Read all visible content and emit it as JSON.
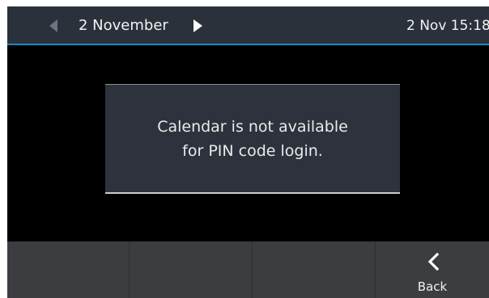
{
  "header": {
    "date_title": "2 November",
    "clock": "2 Nov 15:18",
    "prev_icon": "chevron-left-icon",
    "next_icon": "chevron-right-icon",
    "accent_color": "#1a88c9"
  },
  "dialog": {
    "message": "Calendar is not available\nfor PIN code login."
  },
  "softkeys": [
    {
      "label": ""
    },
    {
      "label": ""
    },
    {
      "label": ""
    },
    {
      "label": "Back",
      "icon": "back-chevron-icon"
    }
  ]
}
